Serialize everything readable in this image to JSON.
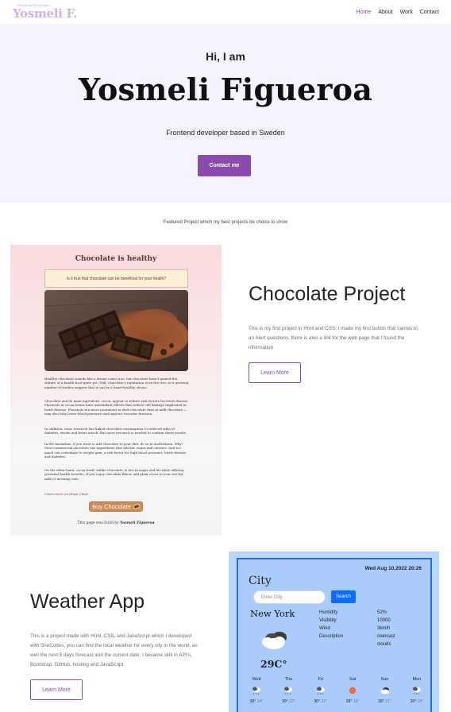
{
  "nav": {
    "logo_tagline": "Frontend Developer",
    "logo_name": "Yosmeli F.",
    "links": [
      "Home",
      "About",
      "Work",
      "Contact"
    ],
    "active_link": "Home"
  },
  "hero": {
    "greeting": "Hi, I am",
    "name": "Yosmeli Figueroa",
    "subtitle": "Frontend developer based in Sweden",
    "cta_label": "Contact me"
  },
  "featured_text": "Featured Project which my best projects be choice to show",
  "project1": {
    "title": "Chocolate Project",
    "description": "This is my first project in Html and CSS. I made my first button that carries to an Alert questions, there is also a link for the web page that I found the information",
    "button_label": "Learn More",
    "screenshot": {
      "title": "Chocolate is healthy",
      "question": "Is it true that chocolate can be beneficial for your health?",
      "paragraphs": [
        "Healthy chocolate sounds like a dream come true, but chocolate hasn't gained the stature of a health food quite yet. Still, chocolate's reputation is on the rise, as a growing number of studies suggest that it can be a heart-healthy choice.",
        "Chocolate and its main ingredient, cocoa, appear to reduce risk factors for heart disease. Flavanols in cocoa beans have antioxidant effects that reduce cell damage implicated in heart disease. Flavanols are more prominent in dark chocolate than in milk chocolate — may also help lower blood pressure and improve vascular function.",
        "In addition, some research has linked chocolate consumption to reduced risks of diabetes, stroke and heart attack. But more research is needed to confirm these results.",
        "In the meantime, if you want to add chocolate to your diet, do so in moderation. Why? Most commercial chocolate has ingredients that add fat, sugar and calories. And too much can contribute to weight gain, a risk factor for high blood pressure, heart disease and diabetes.",
        "On the other hand, cocoa itself, unlike chocolate, is low in sugar and fat while offering potential health benefits. If you enjoy chocolate flavor, add plain cocoa to your low-fat milk or morning oats."
      ],
      "link_text": "Learn more on Mayo Clinic",
      "buy_label": "Buy Chocolate",
      "footer_prefix": "This page was build by",
      "footer_author": "Yosmeli Figueroa"
    }
  },
  "project2": {
    "title": "Weather App",
    "description": "This is a project made with Html, CSS, and JavaScript which I developed with SheCodes, you can find the local weather for every city in the world, as well the next 5 days forecast and the current date. I became skill in API's, Bootstrap, GitHub, hosting and JavaScript.",
    "button_label": "Learn More",
    "screenshot": {
      "date": "Wed Aug 10,2022 20:26",
      "heading": "City",
      "input_placeholder": "Enter City",
      "search_label": "Search",
      "city_name": "New York",
      "temperature": "29C°",
      "stats": [
        {
          "label": "Humidity",
          "value": "52%"
        },
        {
          "label": "Visibility",
          "value": "10000"
        },
        {
          "label": "Wind",
          "value": "3km/h"
        },
        {
          "label": "Description",
          "value": "overcast"
        },
        {
          "label": "",
          "value": "clouds"
        }
      ],
      "forecast": [
        {
          "day": "Wed",
          "icon": "rain-icon",
          "hi": "30°",
          "lo": "24°"
        },
        {
          "day": "Thu",
          "icon": "rain-icon",
          "hi": "30°",
          "lo": "22°"
        },
        {
          "day": "Fri",
          "icon": "rain-icon",
          "hi": "30°",
          "lo": "22°"
        },
        {
          "day": "Sat",
          "icon": "sun-icon",
          "hi": "28°",
          "lo": "18°"
        },
        {
          "day": "Sun",
          "icon": "cloud-icon",
          "hi": "28°",
          "lo": "21°"
        },
        {
          "day": "Mon",
          "icon": "rain-icon",
          "hi": "20°",
          "lo": "19°"
        }
      ]
    }
  },
  "colors": {
    "accent": "#8a4baf",
    "hero_bg": "#f5f3fd",
    "weather_border": "#2d6ad3",
    "search_button": "#0d6efd"
  }
}
